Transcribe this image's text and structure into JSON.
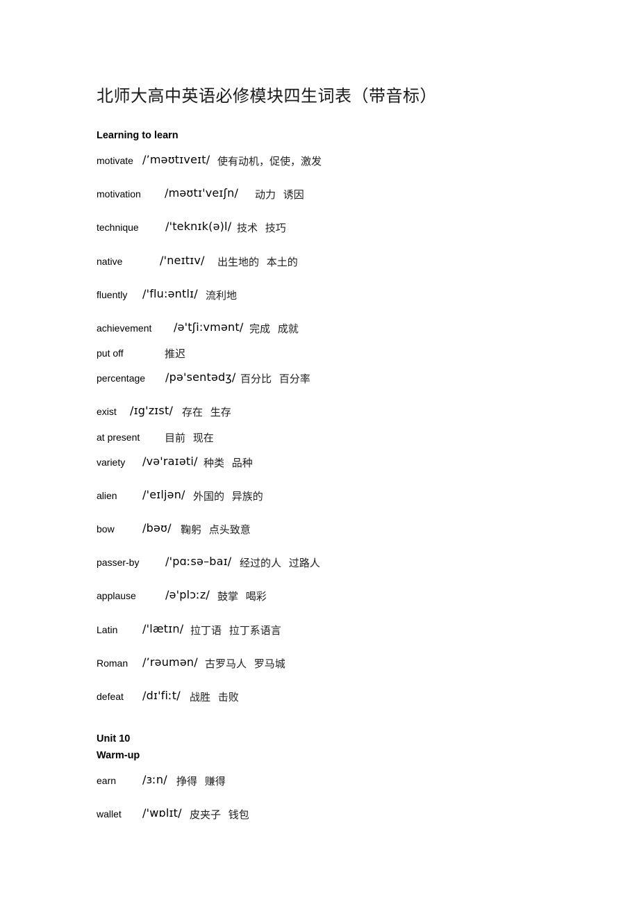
{
  "document": {
    "title": "北师大高中英语必修模块四生词表（带音标）",
    "sections": [
      {
        "heading": "Learning to learn",
        "entries": [
          {
            "word": "motivate",
            "ipa": "/’məʊtɪveɪt/",
            "meaning": "使有动机，促使，激发"
          },
          {
            "word": "motivation",
            "ipa": "/məʊtɪ'veɪʃn/",
            "meaning": "动力 诱因"
          },
          {
            "word": "technique",
            "ipa": "/'teknɪk(ə)l/",
            "meaning": "技术 技巧"
          },
          {
            "word": "native",
            "ipa": "/'neɪtɪv/",
            "meaning": "出生地的 本土的"
          },
          {
            "word": "fluently",
            "ipa": "/'flu:əntlɪ/",
            "meaning": "流利地"
          },
          {
            "word": "achievement",
            "ipa": "/ə'tʃi:vmənt/",
            "meaning": "完成 成就"
          },
          {
            "word": "put off",
            "ipa": "",
            "meaning": "推迟"
          },
          {
            "word": "percentage",
            "ipa": "/pə'sentədʒ/",
            "meaning": "百分比 百分率"
          },
          {
            "word": "exist",
            "ipa": "/ɪg'zɪst/",
            "meaning": "存在 生存"
          },
          {
            "word": "at present",
            "ipa": "",
            "meaning": "目前 现在"
          },
          {
            "word": "variety",
            "ipa": "/və'raɪəti/",
            "meaning": "种类 品种"
          },
          {
            "word": "alien",
            "ipa": "/'eɪljən/",
            "meaning": "外国的 异族的"
          },
          {
            "word": "bow",
            "ipa": "/bəʊ/",
            "meaning": "鞠躬 点头致意"
          },
          {
            "word": "passer-by",
            "ipa": "/'pɑːsə–baɪ/",
            "meaning": "经过的人 过路人"
          },
          {
            "word": "applause",
            "ipa": "/ə'plɔːz/",
            "meaning": "鼓掌 喝彩"
          },
          {
            "word": "Latin",
            "ipa": "/'lætɪn/",
            "meaning": "拉丁语 拉丁系语言"
          },
          {
            "word": "Roman",
            "ipa": "/’rəumən/",
            "meaning": "古罗马人 罗马城"
          },
          {
            "word": "defeat",
            "ipa": "/dɪ'fiːt/",
            "meaning": "战胜 击败"
          }
        ]
      },
      {
        "heading": "Unit 10",
        "subheading": "Warm-up",
        "entries": [
          {
            "word": "earn",
            "ipa": "/ɜːn/",
            "meaning": "挣得 赚得"
          },
          {
            "word": "wallet",
            "ipa": "/'wɒlɪt/",
            "meaning": "皮夹子 钱包"
          }
        ]
      }
    ]
  }
}
